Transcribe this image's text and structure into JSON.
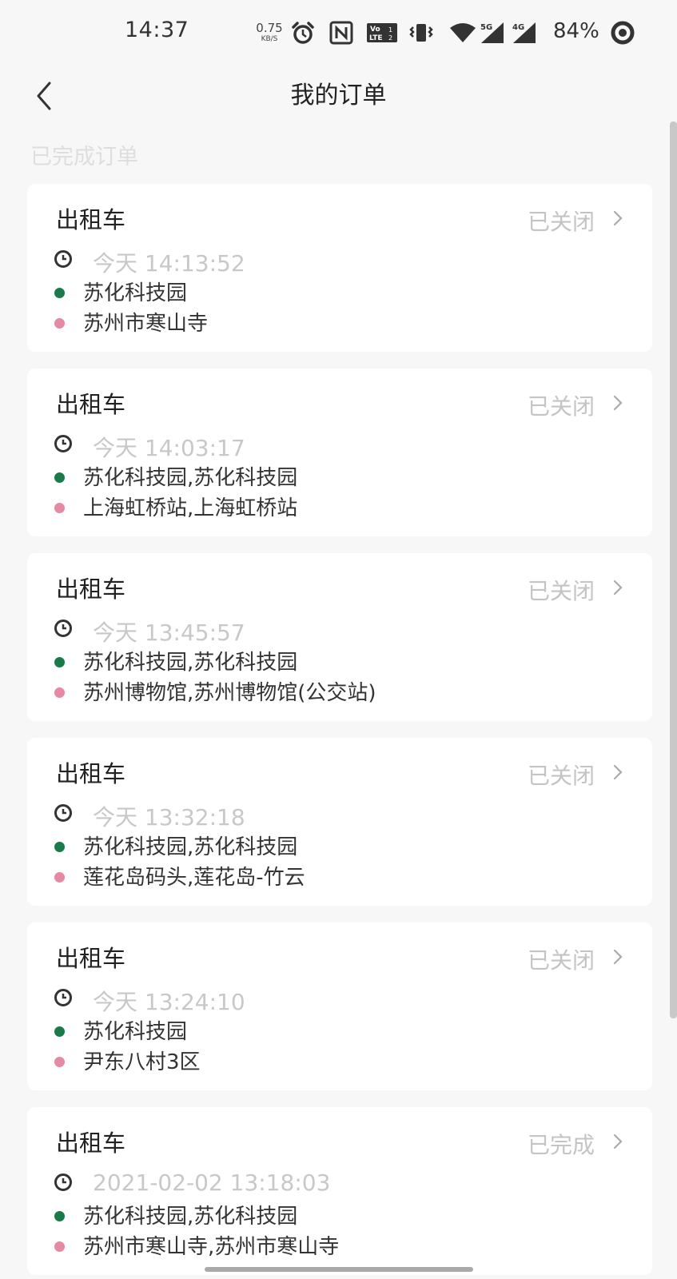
{
  "status_bar": {
    "time": "14:37",
    "net_speed_value": "0.75",
    "net_speed_unit": "KB/S",
    "battery": "84%",
    "icons": [
      "alarm-icon",
      "nfc-icon",
      "volte-icon",
      "vibrate-icon",
      "wifi-icon",
      "signal-5g-icon",
      "signal-4g-icon",
      "battery-ring-icon"
    ]
  },
  "nav": {
    "title": "我的订单"
  },
  "section_label": "已完成订单",
  "orders": [
    {
      "type": "出租车",
      "status": "已关闭",
      "time": "今天 14:13:52",
      "start": "苏化科技园",
      "end": "苏州市寒山寺"
    },
    {
      "type": "出租车",
      "status": "已关闭",
      "time": "今天 14:03:17",
      "start": "苏化科技园,苏化科技园",
      "end": "上海虹桥站,上海虹桥站"
    },
    {
      "type": "出租车",
      "status": "已关闭",
      "time": "今天 13:45:57",
      "start": "苏化科技园,苏化科技园",
      "end": "苏州博物馆,苏州博物馆(公交站)"
    },
    {
      "type": "出租车",
      "status": "已关闭",
      "time": "今天 13:32:18",
      "start": "苏化科技园,苏化科技园",
      "end": "莲花岛码头,莲花岛-竹云"
    },
    {
      "type": "出租车",
      "status": "已关闭",
      "time": "今天 13:24:10",
      "start": "苏化科技园",
      "end": "尹东八村3区"
    },
    {
      "type": "出租车",
      "status": "已完成",
      "time": "2021-02-02 13:18:03",
      "start": "苏化科技园,苏化科技园",
      "end": "苏州市寒山寺,苏州市寒山寺"
    }
  ],
  "colors": {
    "start_dot": "#1b7a4a",
    "end_dot": "#e58aa4",
    "status_text": "#c4c4c4",
    "background": "#f7f7f7"
  }
}
